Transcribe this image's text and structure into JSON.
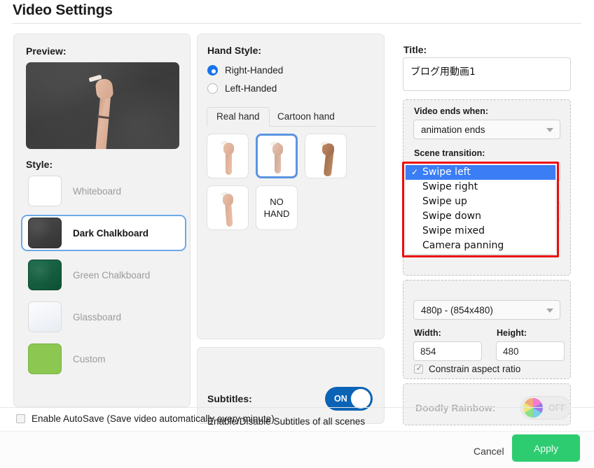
{
  "header": {
    "title": "Video Settings"
  },
  "preview": {
    "label": "Preview:",
    "image_alt": "dark-chalkboard-hand-preview"
  },
  "style": {
    "label": "Style:",
    "items": [
      {
        "name": "Whiteboard",
        "color": "#ffffff",
        "selected": false
      },
      {
        "name": "Dark Chalkboard",
        "color": "#3d3d3d",
        "selected": true
      },
      {
        "name": "Green Chalkboard",
        "color": "#14583a",
        "selected": false
      },
      {
        "name": "Glassboard",
        "color": "#eef1f6",
        "selected": false
      },
      {
        "name": "Custom",
        "color": "#8cc751",
        "selected": false
      }
    ]
  },
  "hand": {
    "label": "Hand Style:",
    "radios": [
      {
        "label": "Right-Handed",
        "selected": true
      },
      {
        "label": "Left-Handed",
        "selected": false
      }
    ],
    "tabs": [
      {
        "label": "Real hand",
        "active": true
      },
      {
        "label": "Cartoon hand",
        "active": false
      }
    ],
    "no_hand_label": "NO\nHAND",
    "no_hand_line1": "NO",
    "no_hand_line2": "HAND"
  },
  "subtitles": {
    "label": "Subtitles:",
    "toggle_state": "ON",
    "description": "Enable/Disable Subtitles of all scenes"
  },
  "right": {
    "title_label": "Title:",
    "title_value": "ブログ用動画1",
    "video_ends_label": "Video ends when:",
    "video_ends_value": "animation ends",
    "scene_transition_label": "Scene transition:",
    "scene_transition_value": "Swipe left",
    "scene_transition_options": [
      {
        "label": "Swipe left",
        "selected": true
      },
      {
        "label": "Swipe right",
        "selected": false
      },
      {
        "label": "Swipe up",
        "selected": false
      },
      {
        "label": "Swipe down",
        "selected": false
      },
      {
        "label": "Swipe mixed",
        "selected": false
      },
      {
        "label": "Camera panning",
        "selected": false
      }
    ],
    "resolution_value": "480p  -  (854x480)",
    "width_label": "Width:",
    "width_value": "854",
    "height_label": "Height:",
    "height_value": "480",
    "constrain_label": "Constrain aspect ratio",
    "constrain_checked": true,
    "rainbow_label": "Doodly Rainbow:",
    "rainbow_state": "OFF"
  },
  "footer": {
    "autosave_label": "Enable AutoSave (Save video automatically every minute)",
    "autosave_checked": false,
    "cancel_label": "Cancel",
    "apply_label": "Apply"
  },
  "colors": {
    "accent_blue": "#1a73e8",
    "select_highlight": "#3a7df5",
    "apply_green": "#2ecc71",
    "toggle_on_blue": "#0b63b5",
    "annotation_red": "#ef0c0c"
  }
}
